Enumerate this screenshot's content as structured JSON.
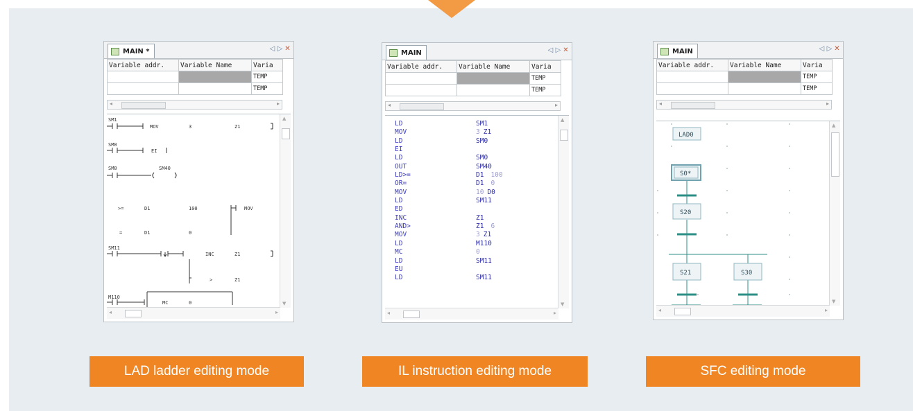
{
  "panels": {
    "lad": {
      "tab_title": "MAIN *",
      "caption": "LAD ladder editing mode",
      "ladder": {
        "r1_contact": "SM1",
        "r1_instr": "MOV",
        "r1_op1": "3",
        "r1_op2": "Z1",
        "r2_contact": "SM0",
        "r2_instr": "EI",
        "r3_contact": "SM0",
        "r3_coil": "SM40",
        "r4_cmp1": ">=",
        "r4_op1": "D1",
        "r4_op2": "100",
        "r4_instr": "MOV",
        "r5_cmp": "=",
        "r5_op1": "D1",
        "r5_op2": "0",
        "r6_contact": "SM11",
        "r6_instr": "INC",
        "r6_op": "Z1",
        "r7_cmp": ">",
        "r7_op": "Z1",
        "r8_contact": "M110",
        "r8_instr": "MC",
        "r8_op": "0"
      }
    },
    "il": {
      "tab_title": "MAIN",
      "caption": "IL instruction editing mode",
      "lines": [
        {
          "op": "LD",
          "a1": "SM1",
          "num": "",
          "a2": ""
        },
        {
          "op": "MOV",
          "a1": "",
          "num": "3",
          "a2": "Z1"
        },
        {
          "op": "LD",
          "a1": "SM0",
          "num": "",
          "a2": ""
        },
        {
          "op": "EI",
          "a1": "",
          "num": "",
          "a2": ""
        },
        {
          "op": "LD",
          "a1": "SM0",
          "num": "",
          "a2": ""
        },
        {
          "op": "OUT",
          "a1": "SM40",
          "num": "",
          "a2": ""
        },
        {
          "op": "LD>=",
          "a1": "D1",
          "num": "",
          "a2": "100"
        },
        {
          "op": "OR=",
          "a1": "D1",
          "num": "",
          "a2": "0"
        },
        {
          "op": "MOV",
          "a1": "",
          "num": "10",
          "a2": "D0"
        },
        {
          "op": "LD",
          "a1": "SM11",
          "num": "",
          "a2": ""
        },
        {
          "op": "ED",
          "a1": "",
          "num": "",
          "a2": ""
        },
        {
          "op": "INC",
          "a1": "Z1",
          "num": "",
          "a2": ""
        },
        {
          "op": "AND>",
          "a1": "Z1",
          "num": "",
          "a2": "6"
        },
        {
          "op": "MOV",
          "a1": "",
          "num": "3",
          "a2": "Z1"
        },
        {
          "op": "LD",
          "a1": "M110",
          "num": "",
          "a2": ""
        },
        {
          "op": "MC",
          "a1": "",
          "num": "0",
          "a2": ""
        },
        {
          "op": "LD",
          "a1": "SM11",
          "num": "",
          "a2": ""
        },
        {
          "op": "EU",
          "a1": "",
          "num": "",
          "a2": ""
        },
        {
          "op": "LD",
          "a1": "SM11",
          "num": "",
          "a2": ""
        }
      ]
    },
    "sfc": {
      "tab_title": "MAIN",
      "caption": "SFC editing mode",
      "steps": {
        "lad0": "LAD0",
        "s0": "S0*",
        "s20": "S20",
        "s21": "S21",
        "s30": "S30"
      }
    }
  },
  "var_table": {
    "headers": [
      "Variable addr.",
      "Variable Name",
      "Varia"
    ],
    "rows": [
      [
        "",
        "",
        "TEMP"
      ],
      [
        "",
        "",
        "TEMP"
      ]
    ]
  },
  "colors": {
    "accent": "#f08523",
    "il_keyword": "#3a3ab8",
    "il_dim": "#9b9bd0",
    "sfc_step": "#8fb7c2",
    "sfc_line": "#2c8f86"
  }
}
